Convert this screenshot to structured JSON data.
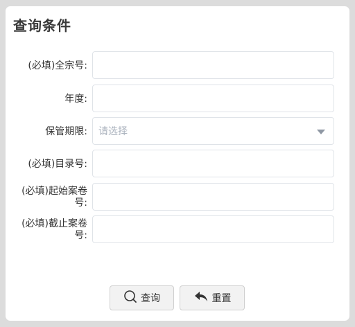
{
  "panel": {
    "title": "查询条件"
  },
  "form": {
    "fields": [
      {
        "label": "(必填)全宗号:",
        "value": "",
        "placeholder": ""
      },
      {
        "label": "年度:",
        "value": "",
        "placeholder": ""
      },
      {
        "label": "保管期限:",
        "type": "select",
        "selected": "请选择"
      },
      {
        "label": "(必填)目录号:",
        "value": "",
        "placeholder": ""
      },
      {
        "label": "(必填)起始案卷号:",
        "value": "",
        "placeholder": ""
      },
      {
        "label": "(必填)截止案卷号:",
        "value": "",
        "placeholder": ""
      }
    ]
  },
  "buttons": {
    "query_label": "查询",
    "query_icon": "search-icon",
    "reset_label": "重置",
    "reset_icon": "undo-icon"
  },
  "colors": {
    "background": "#dcdcdc",
    "panel": "#ffffff",
    "border": "#dfe3e8",
    "placeholder_text": "#aab2bd"
  }
}
